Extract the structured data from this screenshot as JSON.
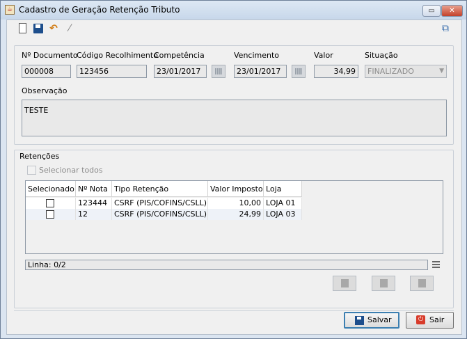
{
  "window": {
    "title": "Cadastro de Geração Retenção Tributo",
    "min_glyph": "▭",
    "close_glyph": "✕"
  },
  "toolbar": {
    "undo_glyph": "↶",
    "wand_glyph": "⁄",
    "window_glyph": "⧉"
  },
  "form": {
    "documento": {
      "label": "Nº Documento",
      "value": "000008"
    },
    "codigo": {
      "label": "Código Recolhimento",
      "value": "123456"
    },
    "competencia": {
      "label": "Competência",
      "value": "23/01/2017"
    },
    "vencimento": {
      "label": "Vencimento",
      "value": "23/01/2017"
    },
    "valor": {
      "label": "Valor",
      "value": "34,99"
    },
    "situacao": {
      "label": "Situação",
      "value": "FINALIZADO"
    },
    "observacao": {
      "label": "Observação",
      "value": "TESTE"
    }
  },
  "retencoes": {
    "title": "Retenções",
    "select_all_label": "Selecionar todos",
    "columns": [
      "Selecionado",
      "Nº Nota",
      "Tipo Retenção",
      "Valor Imposto",
      "Loja"
    ],
    "rows": [
      {
        "selected": false,
        "nota": "123444",
        "tipo": "CSRF (PIS/COFINS/CSLL)",
        "valor": "10,00",
        "loja": "LOJA 01"
      },
      {
        "selected": false,
        "nota": "12",
        "tipo": "CSRF (PIS/COFINS/CSLL)",
        "valor": "24,99",
        "loja": "LOJA 03"
      }
    ],
    "status": "Linha: 0/2"
  },
  "buttons": {
    "save": "Salvar",
    "exit": "Sair"
  },
  "colors": {
    "window_bg": "#dbe5f1",
    "client_bg": "#f0f0f0",
    "focus_border": "#3c7fb1",
    "exit_icon": "#d83b2a"
  }
}
